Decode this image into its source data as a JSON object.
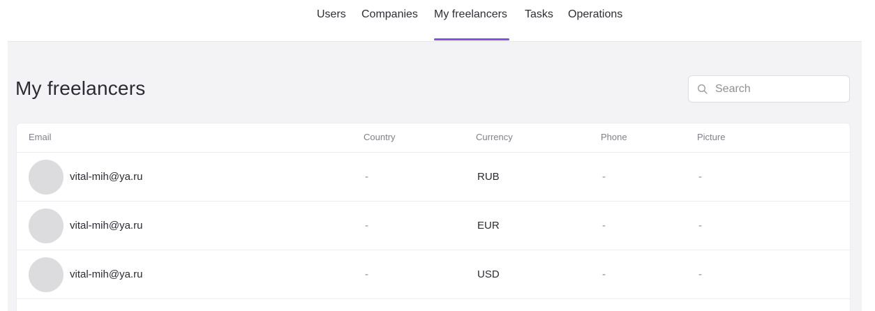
{
  "nav": {
    "items": [
      {
        "label": "Users"
      },
      {
        "label": "Companies"
      },
      {
        "label": "My freelancers",
        "active": true
      },
      {
        "label": "Tasks"
      },
      {
        "label": "Operations"
      }
    ],
    "accent_color": "#8a4fe0"
  },
  "page": {
    "title": "My freelancers"
  },
  "search": {
    "placeholder": "Search",
    "icon": "search-icon"
  },
  "table": {
    "columns": [
      "Email",
      "Country",
      "Currency",
      "Phone",
      "Picture"
    ],
    "rows": [
      {
        "email": "vital-mih@ya.ru",
        "country": "-",
        "currency": "RUB",
        "phone": "-",
        "picture": "-"
      },
      {
        "email": "vital-mih@ya.ru",
        "country": "-",
        "currency": "EUR",
        "phone": "-",
        "picture": "-"
      },
      {
        "email": "vital-mih@ya.ru",
        "country": "-",
        "currency": "USD",
        "phone": "-",
        "picture": "-"
      }
    ]
  }
}
